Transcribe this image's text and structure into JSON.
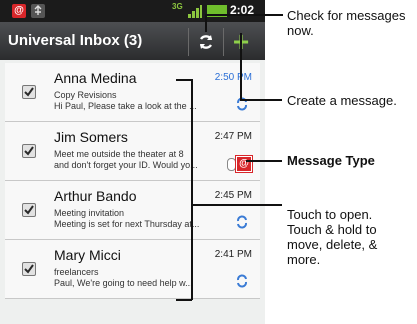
{
  "status_bar": {
    "time": "2:02",
    "network": "3G",
    "notification_icons": [
      "motorola-icon",
      "usb-icon"
    ]
  },
  "title_bar": {
    "title": "Universal Inbox (3)",
    "refresh_icon": "refresh-icon",
    "compose_label": "+"
  },
  "messages": [
    {
      "sender": "Anna Medina",
      "time": "2:50 PM",
      "line1": "Copy Revisions",
      "line2": "Hi Paul, Please take a look at the ...",
      "type": "sync",
      "unread": true
    },
    {
      "sender": "Jim Somers",
      "time": "2:47 PM",
      "line1": "Meet me outside the theater at 8",
      "line2": "and don't forget your ID. Would yo...",
      "type": "email",
      "attachment": true
    },
    {
      "sender": "Arthur Bando",
      "time": "2:45 PM",
      "line1": "Meeting invitation",
      "line2": "Meeting is set for next Thursday at...",
      "type": "sync"
    },
    {
      "sender": "Mary Micci",
      "time": "2:41 PM",
      "line1": "freelancers",
      "line2": "Paul, We're going to need help w...",
      "type": "sync"
    }
  ],
  "callouts": {
    "check": "Check for messages now.",
    "create": "Create a message.",
    "type": "Message Type",
    "touch": "Touch to open. Touch & hold to move, delete, & more."
  },
  "colors": {
    "accent_green": "#8ed04a",
    "unread_blue": "#2b6fd6",
    "email_red": "#d8262a"
  }
}
